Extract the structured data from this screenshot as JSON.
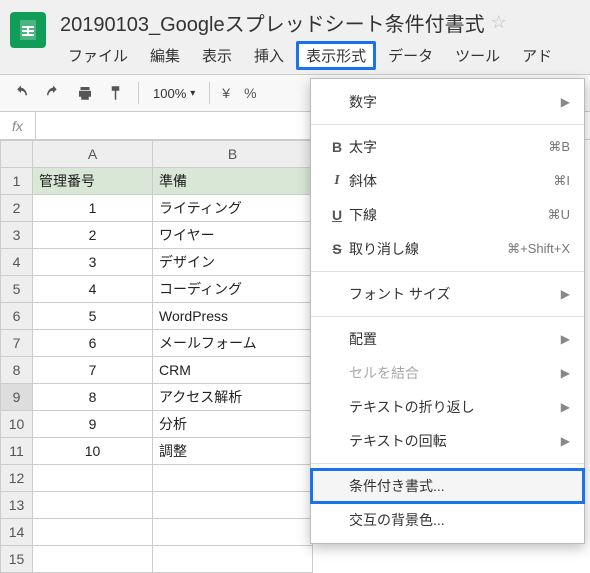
{
  "doc": {
    "title": "20190103_Googleスプレッドシート条件付書式"
  },
  "menubar": {
    "file": "ファイル",
    "edit": "編集",
    "view": "表示",
    "insert": "挿入",
    "format": "表示形式",
    "data": "データ",
    "tools": "ツール",
    "addons": "アド"
  },
  "toolbar": {
    "zoom": "100%",
    "currency": "¥",
    "percent": "%"
  },
  "fx": {
    "label": "fx"
  },
  "columns": {
    "A": "A",
    "B": "B"
  },
  "headerRow": {
    "A": "管理番号",
    "B": "準備"
  },
  "rows": [
    {
      "n": "1",
      "a": "1",
      "b": "ライティング"
    },
    {
      "n": "2",
      "a": "2",
      "b": "ワイヤー"
    },
    {
      "n": "3",
      "a": "3",
      "b": "デザイン"
    },
    {
      "n": "4",
      "a": "4",
      "b": "コーディング"
    },
    {
      "n": "5",
      "a": "5",
      "b": "WordPress"
    },
    {
      "n": "6",
      "a": "6",
      "b": "メールフォーム"
    },
    {
      "n": "7",
      "a": "7",
      "b": "CRM"
    },
    {
      "n": "8",
      "a": "8",
      "b": "アクセス解析"
    },
    {
      "n": "9",
      "a": "9",
      "b": "分析"
    },
    {
      "n": "10",
      "a": "10",
      "b": "調整"
    },
    {
      "n": "11",
      "a": "",
      "b": ""
    },
    {
      "n": "12",
      "a": "",
      "b": ""
    },
    {
      "n": "13",
      "a": "",
      "b": ""
    },
    {
      "n": "14",
      "a": "",
      "b": ""
    }
  ],
  "dropdown": {
    "number": {
      "label": "数字"
    },
    "bold": {
      "icon": "B",
      "label": "太字",
      "shortcut": "⌘B"
    },
    "italic": {
      "icon": "I",
      "label": "斜体",
      "shortcut": "⌘I"
    },
    "underline": {
      "icon": "U",
      "label": "下線",
      "shortcut": "⌘U"
    },
    "strike": {
      "icon": "S",
      "label": "取り消し線",
      "shortcut": "⌘+Shift+X"
    },
    "fontsize": {
      "label": "フォント サイズ"
    },
    "align": {
      "label": "配置"
    },
    "merge": {
      "label": "セルを結合"
    },
    "wrap": {
      "label": "テキストの折り返し"
    },
    "rotate": {
      "label": "テキストの回転"
    },
    "conditional": {
      "label": "条件付き書式..."
    },
    "alternating": {
      "label": "交互の背景色..."
    }
  }
}
